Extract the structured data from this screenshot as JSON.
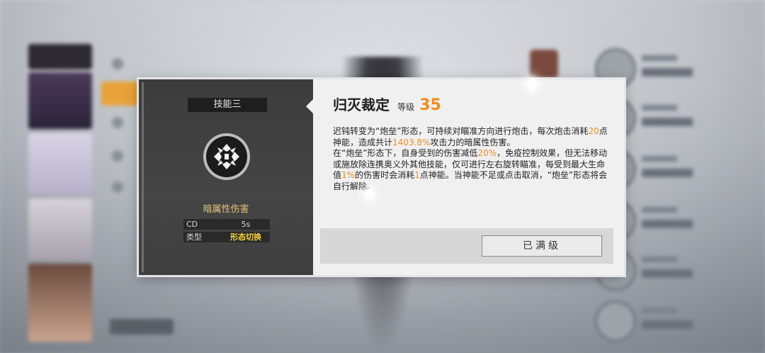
{
  "skill_panel": {
    "slot_label": "技能三",
    "damage_type": "暗属性伤害",
    "stats": [
      {
        "key": "CD",
        "value": "5s"
      },
      {
        "key": "类型",
        "value": "形态切换"
      }
    ]
  },
  "skill_detail": {
    "title": "归灭裁定",
    "level_label": "等级",
    "level_value": "35",
    "description_parts": [
      {
        "t": "迟钝转变为“炮垒”形态，可持续对瞄准方向进行炮击，每次炮击消耗"
      },
      {
        "t": "20",
        "hl": true
      },
      {
        "t": "点神能，造成共计"
      },
      {
        "t": "1403.8%",
        "hl": true
      },
      {
        "t": "攻击力的暗属性伤害。",
        "br": true
      },
      {
        "t": "在“炮垒”形态下，自身受到的伤害减低"
      },
      {
        "t": "20%",
        "hl": true
      },
      {
        "t": "，免疫控制效果，但无法移动或施放除连携奥义外其他技能，仅可进行左右旋转瞄准，每受到最大生命值"
      },
      {
        "t": "1%",
        "hl": true
      },
      {
        "t": "的伤害时会消耗"
      },
      {
        "t": "1",
        "hl": true
      },
      {
        "t": "点神能。当神能不足或点击取消，“炮垒”形态将会自行解除。"
      }
    ],
    "max_button_label": "已满级"
  },
  "colors": {
    "accent_orange": "#f08c1e",
    "highlight_yellow": "#f3d33a",
    "damage_type_gold": "#e8c27a"
  },
  "icons": {
    "skill_icon": "artillery-skill-icon"
  }
}
